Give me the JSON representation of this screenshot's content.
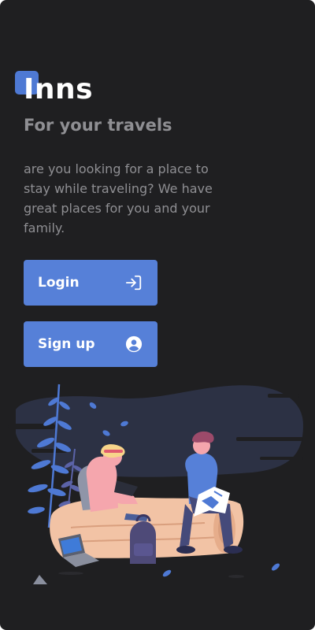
{
  "app": {
    "title": "Inns",
    "subtitle": "For your travels",
    "description": "are you looking for a place to stay while traveling? We have great places for you and your family."
  },
  "actions": {
    "login_label": "Login",
    "login_icon": "login-arrow-icon",
    "signup_label": "Sign up",
    "signup_icon": "account-circle-icon"
  },
  "illustration": {
    "name": "travelers-camping-illustration"
  },
  "colors": {
    "background": "#1f1f21",
    "accent": "#5680d8",
    "title": "#ffffff",
    "muted_text": "#8f8f93"
  }
}
